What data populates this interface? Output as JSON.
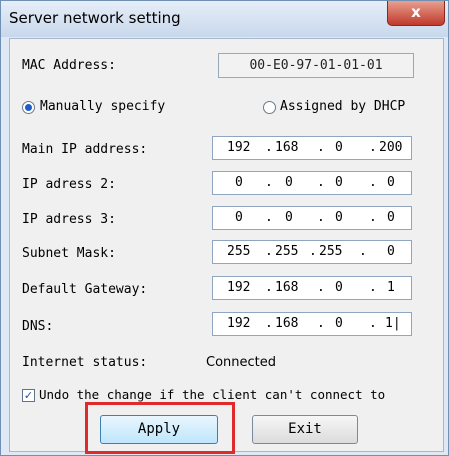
{
  "window": {
    "title": "Server network setting",
    "close_glyph": "x"
  },
  "mac": {
    "label": "MAC Address:",
    "value": "00-E0-97-01-01-01"
  },
  "mode": {
    "manual_label": "Manually specify",
    "dhcp_label": "Assigned by DHCP",
    "selected": "manual"
  },
  "fields": {
    "main_ip": {
      "label": "Main IP address:",
      "parts": [
        "192",
        "168",
        "0",
        "200"
      ]
    },
    "ip2": {
      "label": "IP adress 2:",
      "parts": [
        "0",
        "0",
        "0",
        "0"
      ]
    },
    "ip3": {
      "label": "IP adress 3:",
      "parts": [
        "0",
        "0",
        "0",
        "0"
      ]
    },
    "subnet": {
      "label": "Subnet Mask:",
      "parts": [
        "255",
        "255",
        "255",
        "0"
      ]
    },
    "gateway": {
      "label": "Default Gateway:",
      "parts": [
        "192",
        "168",
        "0",
        "1"
      ]
    },
    "dns": {
      "label": "DNS:",
      "parts": [
        "192",
        "168",
        "0",
        "1|"
      ]
    }
  },
  "status": {
    "label": "Internet status:",
    "value": "Connected"
  },
  "undo": {
    "label": "Undo the change if the client can't connect to",
    "checked": true
  },
  "buttons": {
    "apply": "Apply",
    "exit": "Exit"
  },
  "colors": {
    "highlight": "#e02b2b",
    "close": "#c0392b"
  }
}
